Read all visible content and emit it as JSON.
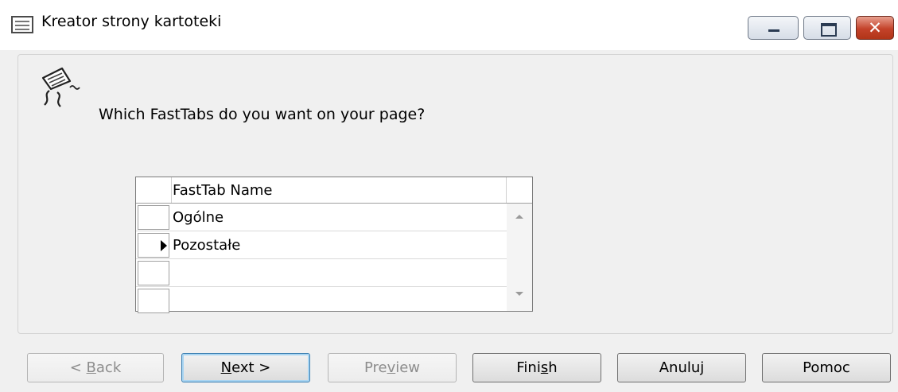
{
  "window": {
    "title": "Kreator strony kartoteki",
    "controls": {
      "minimize": "minimize",
      "maximize": "maximize",
      "close": "✕"
    }
  },
  "wizard": {
    "icon": "wizard-page-icon",
    "question": "Which FastTabs do you want on your page?"
  },
  "grid": {
    "column_header": "FastTab Name",
    "rows": [
      {
        "name": "Ogólne",
        "current": false
      },
      {
        "name": "Pozostałe",
        "current": true
      },
      {
        "name": "",
        "current": false
      },
      {
        "name": "",
        "current": false
      }
    ]
  },
  "buttons": {
    "back": {
      "before": "< ",
      "mnemonic": "B",
      "after": "ack",
      "enabled": false
    },
    "next": {
      "before": "",
      "mnemonic": "N",
      "after": "ext >",
      "enabled": true
    },
    "preview": {
      "before": "Pre",
      "mnemonic": "v",
      "after": "iew",
      "enabled": false
    },
    "finish": {
      "before": "Fini",
      "mnemonic": "s",
      "after": "h",
      "enabled": true
    },
    "cancel": "Anuluj",
    "help": "Pomoc"
  }
}
